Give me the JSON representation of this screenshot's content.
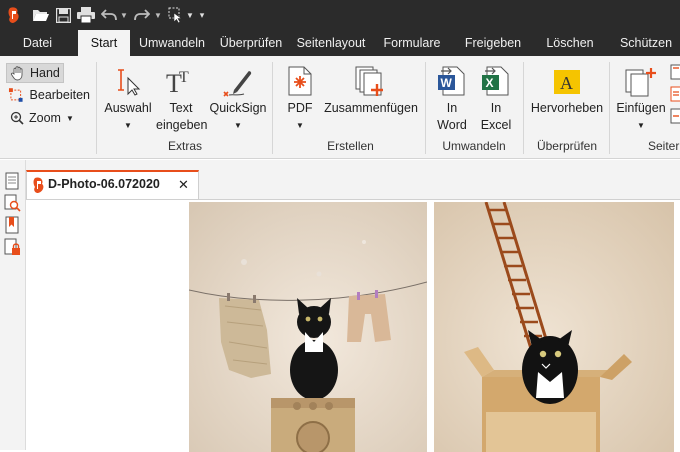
{
  "menu": {
    "tabs": [
      {
        "label": "Datei"
      },
      {
        "label": "Start"
      },
      {
        "label": "Umwandeln"
      },
      {
        "label": "Überprüfen"
      },
      {
        "label": "Seitenlayout"
      },
      {
        "label": "Formulare"
      },
      {
        "label": "Freigeben"
      },
      {
        "label": "Löschen"
      },
      {
        "label": "Schützen"
      }
    ]
  },
  "tools": {
    "hand": "Hand",
    "bearbeiten": "Bearbeiten",
    "zoom": "Zoom"
  },
  "ribbon": {
    "auswahl": "Auswahl",
    "text_line1": "Text",
    "text_line2": "eingeben",
    "quicksign": "QuickSign",
    "extras": "Extras",
    "pdf": "PDF",
    "zusammenfuegen": "Zusammenfügen",
    "erstellen": "Erstellen",
    "in": "In",
    "word": "Word",
    "excel": "Excel",
    "umwandeln": "Umwandeln",
    "hervorheben": "Hervorheben",
    "ueberpruefen": "Überprüfen",
    "einfuegen": "Einfügen",
    "seiten_partial": "Seiter"
  },
  "document": {
    "tab_title": "D-Photo-06.072020",
    "close": "✕"
  },
  "icons": {
    "app": "app-logo-icon",
    "open": "folder-open-icon",
    "save": "save-icon",
    "print": "printer-icon",
    "undo": "undo-icon",
    "redo": "redo-icon",
    "cursor": "cursor-select-icon",
    "more": "customize-toolbar-icon"
  },
  "colors": {
    "accent": "#e84e1b",
    "dark_bar": "#2b2b2b",
    "ribbon_bg": "#f3f3f3",
    "word_blue": "#2b579a",
    "excel_green": "#217346",
    "highlight_yellow": "#f5c400"
  }
}
